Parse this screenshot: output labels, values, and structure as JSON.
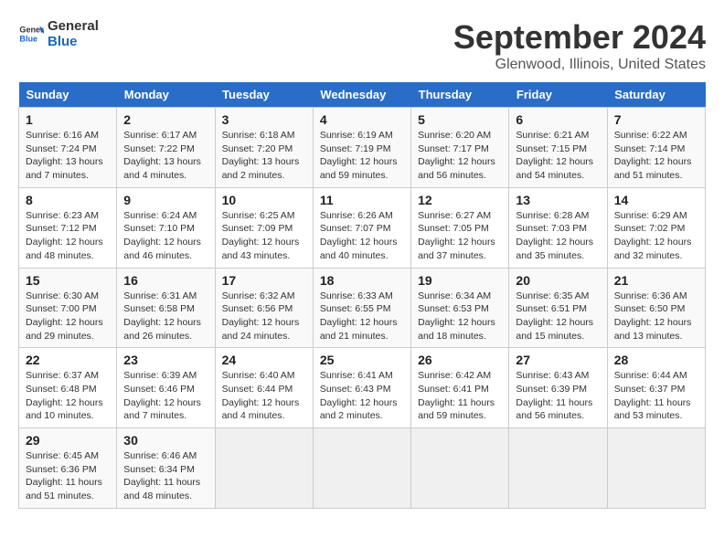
{
  "logo": {
    "line1": "General",
    "line2": "Blue"
  },
  "title": "September 2024",
  "subtitle": "Glenwood, Illinois, United States",
  "days_of_week": [
    "Sunday",
    "Monday",
    "Tuesday",
    "Wednesday",
    "Thursday",
    "Friday",
    "Saturday"
  ],
  "weeks": [
    [
      {
        "day": 1,
        "info": "Sunrise: 6:16 AM\nSunset: 7:24 PM\nDaylight: 13 hours\nand 7 minutes."
      },
      {
        "day": 2,
        "info": "Sunrise: 6:17 AM\nSunset: 7:22 PM\nDaylight: 13 hours\nand 4 minutes."
      },
      {
        "day": 3,
        "info": "Sunrise: 6:18 AM\nSunset: 7:20 PM\nDaylight: 13 hours\nand 2 minutes."
      },
      {
        "day": 4,
        "info": "Sunrise: 6:19 AM\nSunset: 7:19 PM\nDaylight: 12 hours\nand 59 minutes."
      },
      {
        "day": 5,
        "info": "Sunrise: 6:20 AM\nSunset: 7:17 PM\nDaylight: 12 hours\nand 56 minutes."
      },
      {
        "day": 6,
        "info": "Sunrise: 6:21 AM\nSunset: 7:15 PM\nDaylight: 12 hours\nand 54 minutes."
      },
      {
        "day": 7,
        "info": "Sunrise: 6:22 AM\nSunset: 7:14 PM\nDaylight: 12 hours\nand 51 minutes."
      }
    ],
    [
      {
        "day": 8,
        "info": "Sunrise: 6:23 AM\nSunset: 7:12 PM\nDaylight: 12 hours\nand 48 minutes."
      },
      {
        "day": 9,
        "info": "Sunrise: 6:24 AM\nSunset: 7:10 PM\nDaylight: 12 hours\nand 46 minutes."
      },
      {
        "day": 10,
        "info": "Sunrise: 6:25 AM\nSunset: 7:09 PM\nDaylight: 12 hours\nand 43 minutes."
      },
      {
        "day": 11,
        "info": "Sunrise: 6:26 AM\nSunset: 7:07 PM\nDaylight: 12 hours\nand 40 minutes."
      },
      {
        "day": 12,
        "info": "Sunrise: 6:27 AM\nSunset: 7:05 PM\nDaylight: 12 hours\nand 37 minutes."
      },
      {
        "day": 13,
        "info": "Sunrise: 6:28 AM\nSunset: 7:03 PM\nDaylight: 12 hours\nand 35 minutes."
      },
      {
        "day": 14,
        "info": "Sunrise: 6:29 AM\nSunset: 7:02 PM\nDaylight: 12 hours\nand 32 minutes."
      }
    ],
    [
      {
        "day": 15,
        "info": "Sunrise: 6:30 AM\nSunset: 7:00 PM\nDaylight: 12 hours\nand 29 minutes."
      },
      {
        "day": 16,
        "info": "Sunrise: 6:31 AM\nSunset: 6:58 PM\nDaylight: 12 hours\nand 26 minutes."
      },
      {
        "day": 17,
        "info": "Sunrise: 6:32 AM\nSunset: 6:56 PM\nDaylight: 12 hours\nand 24 minutes."
      },
      {
        "day": 18,
        "info": "Sunrise: 6:33 AM\nSunset: 6:55 PM\nDaylight: 12 hours\nand 21 minutes."
      },
      {
        "day": 19,
        "info": "Sunrise: 6:34 AM\nSunset: 6:53 PM\nDaylight: 12 hours\nand 18 minutes."
      },
      {
        "day": 20,
        "info": "Sunrise: 6:35 AM\nSunset: 6:51 PM\nDaylight: 12 hours\nand 15 minutes."
      },
      {
        "day": 21,
        "info": "Sunrise: 6:36 AM\nSunset: 6:50 PM\nDaylight: 12 hours\nand 13 minutes."
      }
    ],
    [
      {
        "day": 22,
        "info": "Sunrise: 6:37 AM\nSunset: 6:48 PM\nDaylight: 12 hours\nand 10 minutes."
      },
      {
        "day": 23,
        "info": "Sunrise: 6:39 AM\nSunset: 6:46 PM\nDaylight: 12 hours\nand 7 minutes."
      },
      {
        "day": 24,
        "info": "Sunrise: 6:40 AM\nSunset: 6:44 PM\nDaylight: 12 hours\nand 4 minutes."
      },
      {
        "day": 25,
        "info": "Sunrise: 6:41 AM\nSunset: 6:43 PM\nDaylight: 12 hours\nand 2 minutes."
      },
      {
        "day": 26,
        "info": "Sunrise: 6:42 AM\nSunset: 6:41 PM\nDaylight: 11 hours\nand 59 minutes."
      },
      {
        "day": 27,
        "info": "Sunrise: 6:43 AM\nSunset: 6:39 PM\nDaylight: 11 hours\nand 56 minutes."
      },
      {
        "day": 28,
        "info": "Sunrise: 6:44 AM\nSunset: 6:37 PM\nDaylight: 11 hours\nand 53 minutes."
      }
    ],
    [
      {
        "day": 29,
        "info": "Sunrise: 6:45 AM\nSunset: 6:36 PM\nDaylight: 11 hours\nand 51 minutes."
      },
      {
        "day": 30,
        "info": "Sunrise: 6:46 AM\nSunset: 6:34 PM\nDaylight: 11 hours\nand 48 minutes."
      },
      null,
      null,
      null,
      null,
      null
    ]
  ]
}
